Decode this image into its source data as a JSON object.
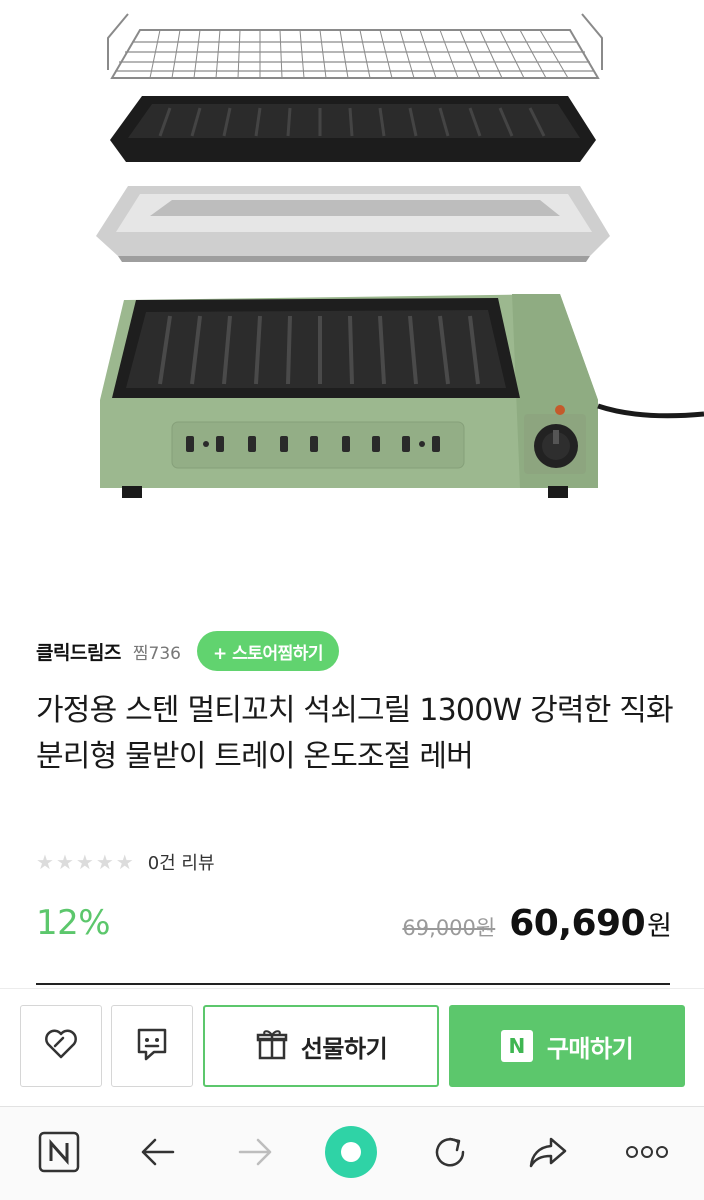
{
  "store": {
    "name": "클릭드림즈",
    "zzim": "찜736",
    "fav_button": "+ 스토어찜하기"
  },
  "product": {
    "title": "가정용 스텐 멀티꼬치 석쇠그릴 1300W 강력한 직화 분리형 물받이 트레이 온도조절 레버",
    "rating_stars": 0,
    "rating_max": 5,
    "review_count": "0건 리뷰",
    "discount": "12%",
    "original_price": "69,000원",
    "sale_price": "60,690",
    "currency": "원",
    "image_alt": "green electric grill with separable grill plate, drip tray and wire rack"
  },
  "purchase_bar": {
    "like_icon": "heart-icon",
    "talk_icon": "talk-icon",
    "gift_label": "선물하기",
    "gift_icon": "gift-icon",
    "buy_label": "구매하기",
    "npay_mark": "N"
  },
  "browser_toolbar": {
    "home_mark": "N",
    "items": [
      "home-icon",
      "back-icon",
      "forward-icon",
      "green-dot-icon",
      "reload-icon",
      "share-icon",
      "more-icon"
    ]
  },
  "colors": {
    "accent_green": "#5cc76c",
    "grill_green": "#9cb88f",
    "text": "#1a1a1a",
    "muted": "#777777"
  }
}
